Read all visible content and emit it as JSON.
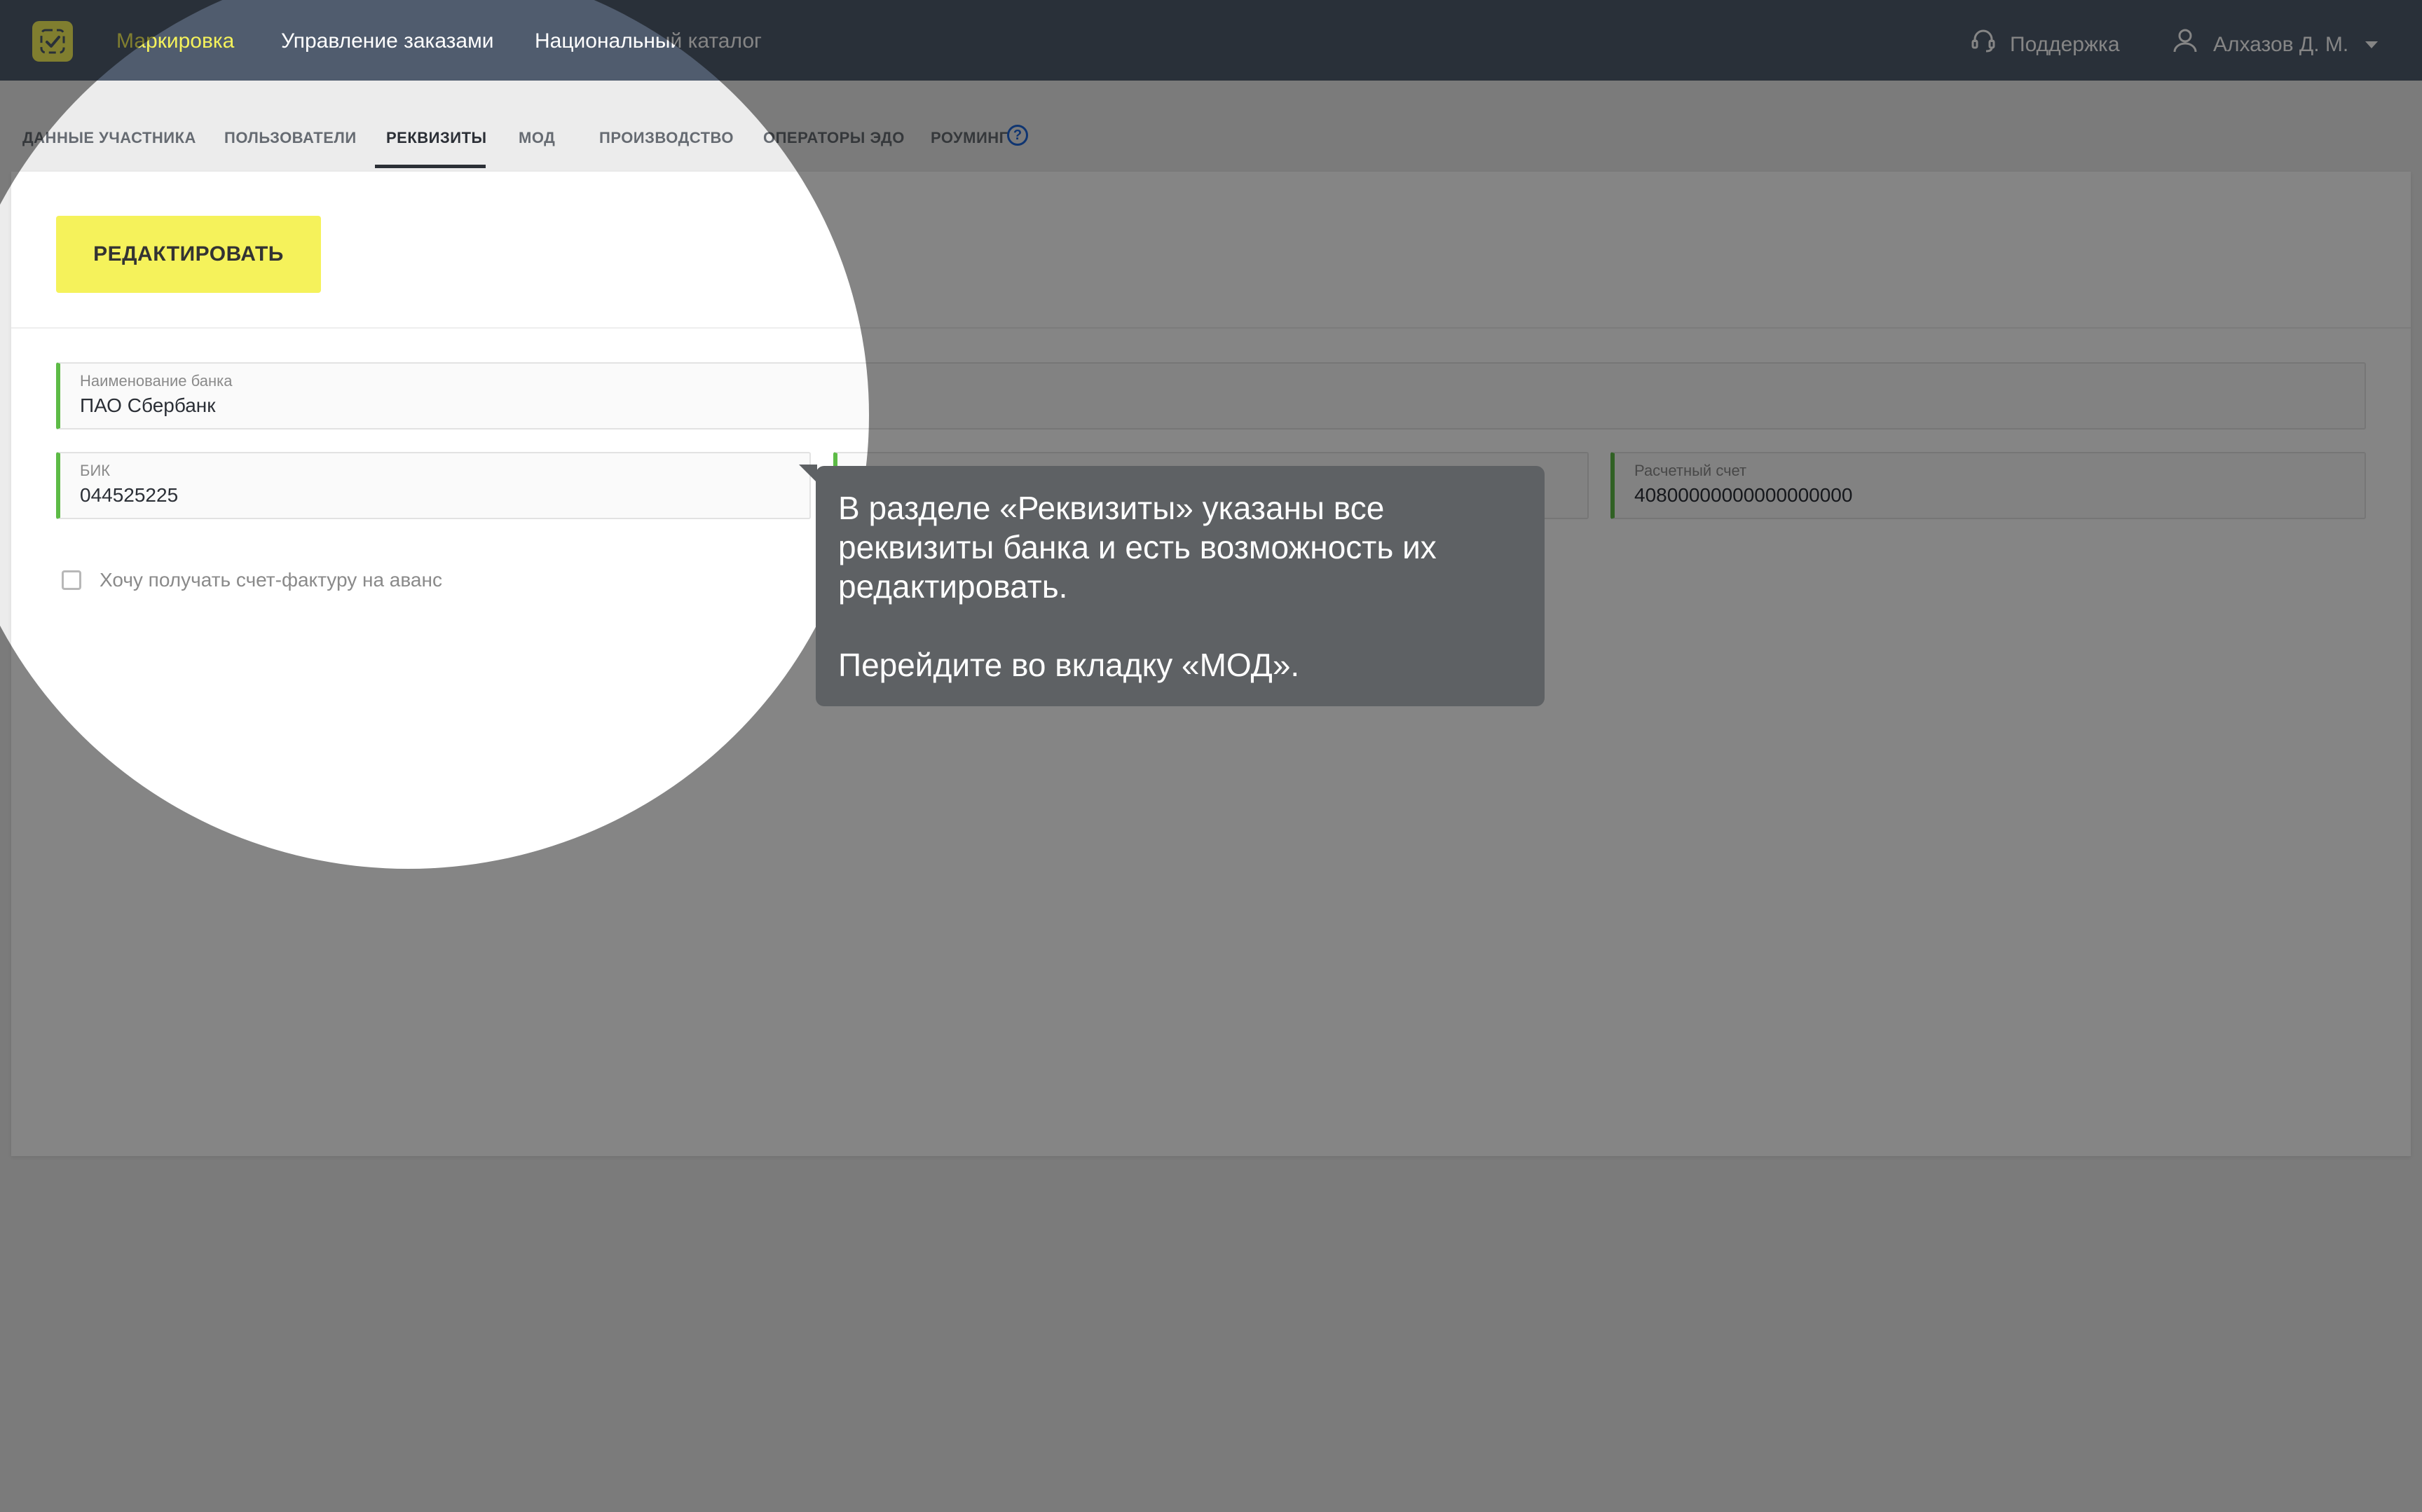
{
  "nav": {
    "items": [
      {
        "label": "Маркировка",
        "active": true
      },
      {
        "label": "Управление заказами",
        "active": false
      },
      {
        "label": "Национальный каталог",
        "active": false
      }
    ],
    "support_label": "Поддержка",
    "user_name": "Алхазов Д. М."
  },
  "tabs": [
    {
      "label": "ДАННЫЕ УЧАСТНИКА"
    },
    {
      "label": "ПОЛЬЗОВАТЕЛИ"
    },
    {
      "label": "РЕКВИЗИТЫ",
      "active": true
    },
    {
      "label": "МОД"
    },
    {
      "label": "ПРОИЗВОДСТВО"
    },
    {
      "label": "ОПЕРАТОРЫ ЭДО"
    },
    {
      "label": "РОУМИНГ"
    }
  ],
  "help_symbol": "?",
  "edit_button_label": "РЕДАКТИРОВАТЬ",
  "fields": {
    "bank_name": {
      "label": "Наименование банка",
      "value": "ПАО Сбербанк"
    },
    "bik": {
      "label": "БИК",
      "value": "044525225"
    },
    "corr_account": {
      "label": "",
      "value": ""
    },
    "account": {
      "label": "Расчетный счет",
      "value": "40800000000000000000"
    }
  },
  "checkbox": {
    "label": "Хочу получать счет-фактуру на аванс",
    "checked": false
  },
  "tooltip": {
    "line1": "В разделе «Реквизиты» указаны все реквизиты банка и есть возможность их редактировать.",
    "line2": "Перейдите во вкладку «МОД»."
  },
  "colors": {
    "topbar": "#505c6e",
    "accent_yellow": "#f5f25b",
    "field_accent_green": "#5dbb46",
    "tooltip_bg": "#5e6164",
    "help_blue": "#1d66d8"
  }
}
